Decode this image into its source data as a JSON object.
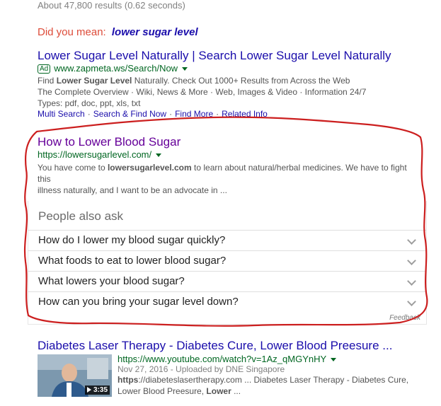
{
  "stats": "About 47,800 results (0.62 seconds)",
  "did_you_mean": {
    "prefix": "Did you mean:",
    "suggestion": "lower sugar level"
  },
  "result_ad": {
    "title": "Lower Sugar Level Naturally | Search Lower Sugar Level Naturally",
    "badge": "Ad",
    "url": "www.zapmeta.ws/Search/Now",
    "line1_pre": "Find ",
    "line1_bold": "Lower Sugar Level",
    "line1_post": " Naturally. Check Out 1000+ Results from Across the Web",
    "line2": "The Complete Overview · Wiki, News & More · Web, Images & Video · Information 24/7",
    "line3": "Types: pdf, doc, ppt, xls, txt",
    "sitelinks": [
      "Multi Search",
      "Search & Find Now",
      "Find More",
      "Related Info"
    ]
  },
  "result_organic": {
    "title": "How to Lower Blood Sugar",
    "url": "https://lowersugarlevel.com/",
    "snip_pre": "You have come to ",
    "snip_bold": "lowersugarlevel.com",
    "snip_post": " to learn about natural/herbal medicines. We have to fight this",
    "snip_line2": "illness naturally, and I want to be an advocate in ..."
  },
  "people_also_ask": {
    "title": "People also ask",
    "questions": [
      "How do I lower my blood sugar quickly?",
      "What foods to eat to lower blood sugar?",
      "What lowers your blood sugar?",
      "How can you bring your sugar level down?"
    ],
    "feedback": "Feedback"
  },
  "result_video": {
    "title": "Diabetes Laser Therapy - Diabetes Cure, Lower Blood Preesure ...",
    "url": "https://www.youtube.com/watch?v=1Az_qMGYnHY",
    "meta": "Nov 27, 2016 - Uploaded by DNE Singapore",
    "snip_bold": "https",
    "snip_post": "://diabeteslasertherapy.com ... Diabetes Laser Therapy - Diabetes Cure,",
    "snip_line2_pre": "Lower Blood Preesure, ",
    "snip_line2_bold": "Lower",
    "snip_line2_post": " ...",
    "duration": "3:35"
  },
  "colors": {
    "link": "#1a0dab",
    "visited": "#660099",
    "url": "#006621",
    "annotation": "#cc1f1f"
  }
}
